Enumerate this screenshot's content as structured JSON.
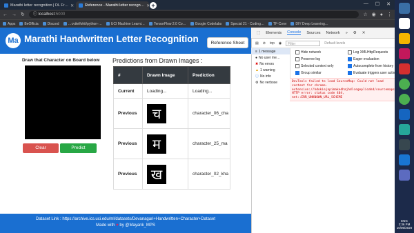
{
  "browser": {
    "tabs": [
      {
        "title": "Marathi letter recognition | DL Fr…",
        "active": false
      },
      {
        "title": "Reference - Marathi letter recogn…",
        "active": true
      }
    ],
    "url_host": "localhost",
    "url_port": ":5000",
    "bookmarks": [
      "Apps",
      "BeOfficia",
      "Discord",
      "…cvttelfohit/python-…",
      "UCI Machine Learni…",
      "TensorFlow 2.0 Co…",
      "Google Codelabs",
      "Special 21 - Coding…",
      "TF-Conv",
      "DIY Deep Learning…"
    ]
  },
  "app": {
    "logo_text": "Ma",
    "title": "Marathi Handwritten Letter Recognition",
    "reference_button": "Reference Sheet",
    "draw_label": "Draw that Character on Board below",
    "clear_button": "Clear",
    "predict_button": "Predict",
    "predictions_heading": "Predictions from Drawn Images :",
    "table": {
      "headers": [
        "#",
        "Drawn Image",
        "Prediction"
      ],
      "rows": [
        {
          "label": "Current",
          "image": "Loading...",
          "prediction": "Loading..."
        },
        {
          "label": "Previous",
          "image_char": "च",
          "prediction": "character_06_cha"
        },
        {
          "label": "Previous",
          "image_char": "म",
          "prediction": "character_25_ma"
        },
        {
          "label": "Previous",
          "image_char": "ख",
          "prediction": "character_02_kha"
        }
      ]
    },
    "footer_dataset": "Dataset Link : https://archive.ics.uci.edu/ml/datasets/Devanagari+Handwritten+Character+Dataset",
    "footer_made_prefix": "Made with",
    "footer_made_suffix": "by @Mayank_MPS"
  },
  "devtools": {
    "tabs": [
      "Elements",
      "Console",
      "Sources",
      "Network"
    ],
    "active_tab": "Console",
    "context": "top",
    "filter_placeholder": "Filter",
    "levels": "Default levels",
    "sidebar": [
      "1 message",
      "No user me…",
      "No errors",
      "1 warning",
      "No info",
      "No verbose"
    ],
    "settings_left": [
      "Hide network",
      "Preserve log",
      "Selected context only",
      "Group similar"
    ],
    "settings_right": [
      "Log XMLHttpRequests",
      "Eager evaluation",
      "Autocomplete from history",
      "Evaluate triggers user activ…"
    ],
    "error_message": "DevTools failed to load SourceMap: Could not load content for chrome-extension://hdokiejnpimakedhajhdlcegeplioahd/sourcemaps/onloadwff.js.map: HTTP error: status code 404, net::ERR_UNKNOWN_URL_SCHEME"
  },
  "taskbar": {
    "time": "3:36 PM",
    "date": "10/06/2020",
    "lang": "ENG"
  }
}
